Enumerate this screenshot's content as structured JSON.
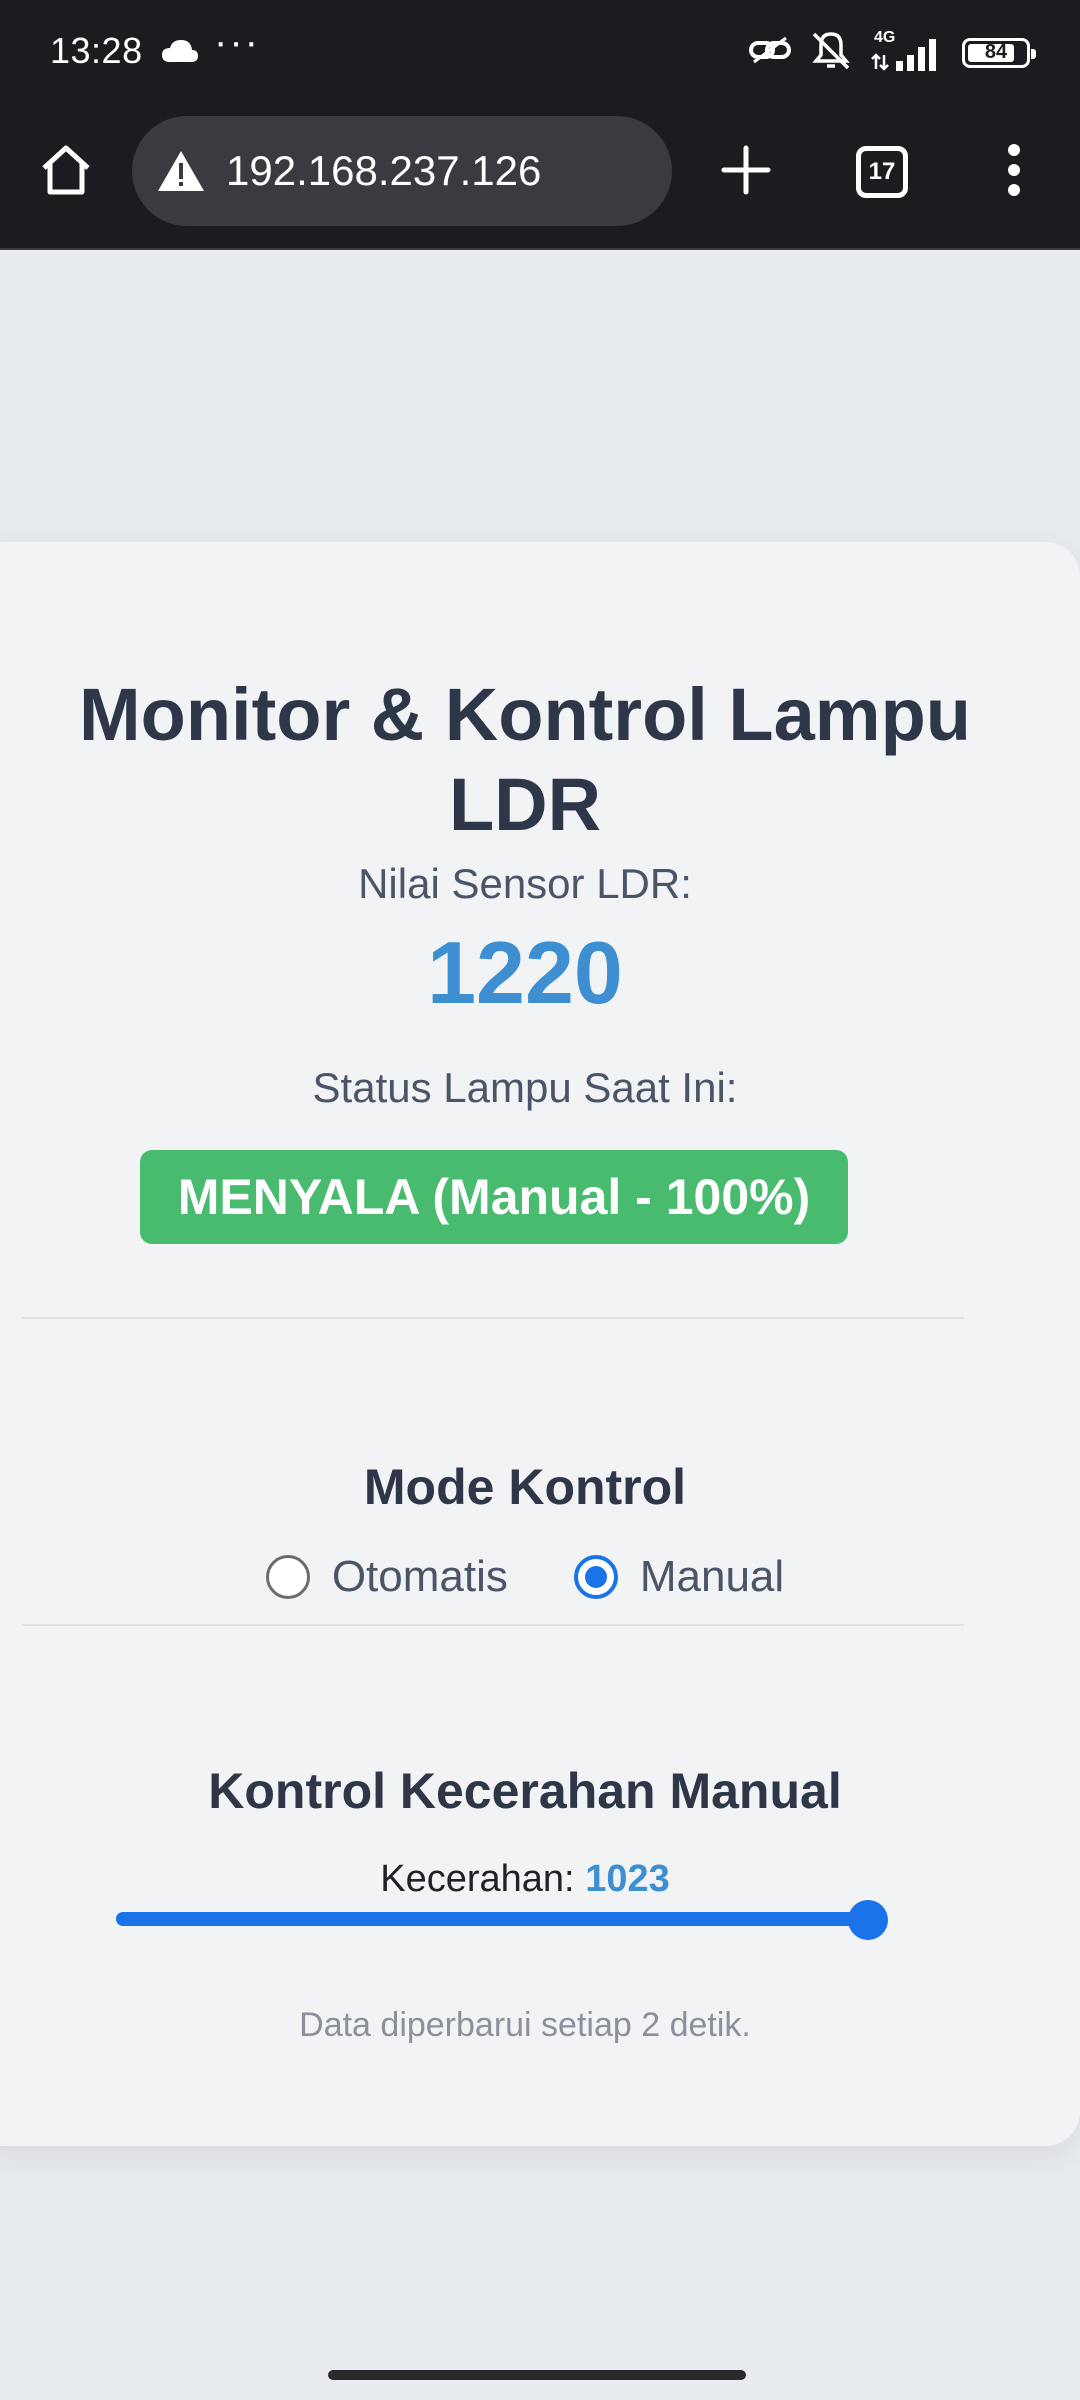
{
  "status_bar": {
    "time": "13:28",
    "more": "···",
    "network": "4G",
    "battery": "84",
    "battery_level_percent": 84
  },
  "browser": {
    "url": "192.168.237.126",
    "tab_count": "17"
  },
  "app": {
    "title": "Monitor & Kontrol Lampu LDR",
    "sensor_label": "Nilai Sensor LDR:",
    "sensor_value": "1220",
    "status_label": "Status Lampu Saat Ini:",
    "status_value": "MENYALA (Manual - 100%)",
    "status_color": "#48bb6f",
    "mode": {
      "title": "Mode Kontrol",
      "options": [
        {
          "label": "Otomatis",
          "checked": false
        },
        {
          "label": "Manual",
          "checked": true
        }
      ]
    },
    "brightness": {
      "title": "Kontrol Kecerahan Manual",
      "label": "Kecerahan:",
      "value": "1023",
      "slider_min": 0,
      "slider_max": 1023,
      "slider_value": 1023
    },
    "footer_note": "Data diperbarui setiap 2 detik.",
    "accent_color": "#1a73e8",
    "value_color": "#3d8fd1"
  }
}
